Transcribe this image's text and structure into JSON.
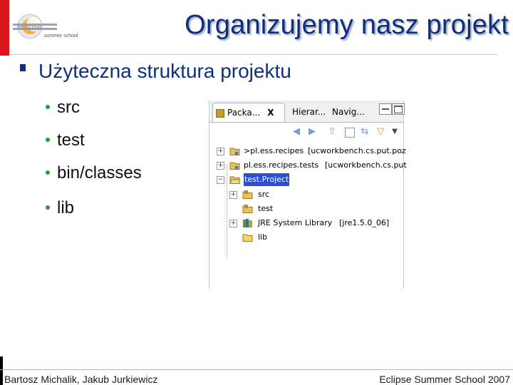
{
  "slide": {
    "title": "Organizujemy nasz projekt",
    "main_bullet": "Użyteczna struktura projektu",
    "sub_bullets": [
      "src",
      "test",
      "bin/classes",
      "lib"
    ]
  },
  "logo": {
    "word": "eclipse",
    "tagline": "summer school"
  },
  "eclipse": {
    "tabs": [
      "Packa...",
      "Hierar...",
      "Navig..."
    ],
    "close_glyph": "X",
    "tree": [
      {
        "label": ">pl.ess.recipes",
        "detail": "[ucworkbench.cs.put.poz"
      },
      {
        "label": "pl.ess.recipes.tests",
        "detail": "[ucworkbench.cs.put"
      },
      {
        "label": "test.Project",
        "detail": ""
      },
      {
        "label": "src",
        "detail": ""
      },
      {
        "label": "test",
        "detail": ""
      },
      {
        "label": "JRE System Library",
        "detail": "[jre1.5.0_06]"
      },
      {
        "label": "lib",
        "detail": ""
      }
    ]
  },
  "footer": {
    "left": "Bartosz Michalik, Jakub Jurkiewicz",
    "right": "Eclipse Summer School 2007"
  },
  "colors": {
    "accent_red": "#d8161b",
    "title_blue": "#0c2f80",
    "selection": "#2d4ecf",
    "bullet_green": "#2f9a2f"
  }
}
